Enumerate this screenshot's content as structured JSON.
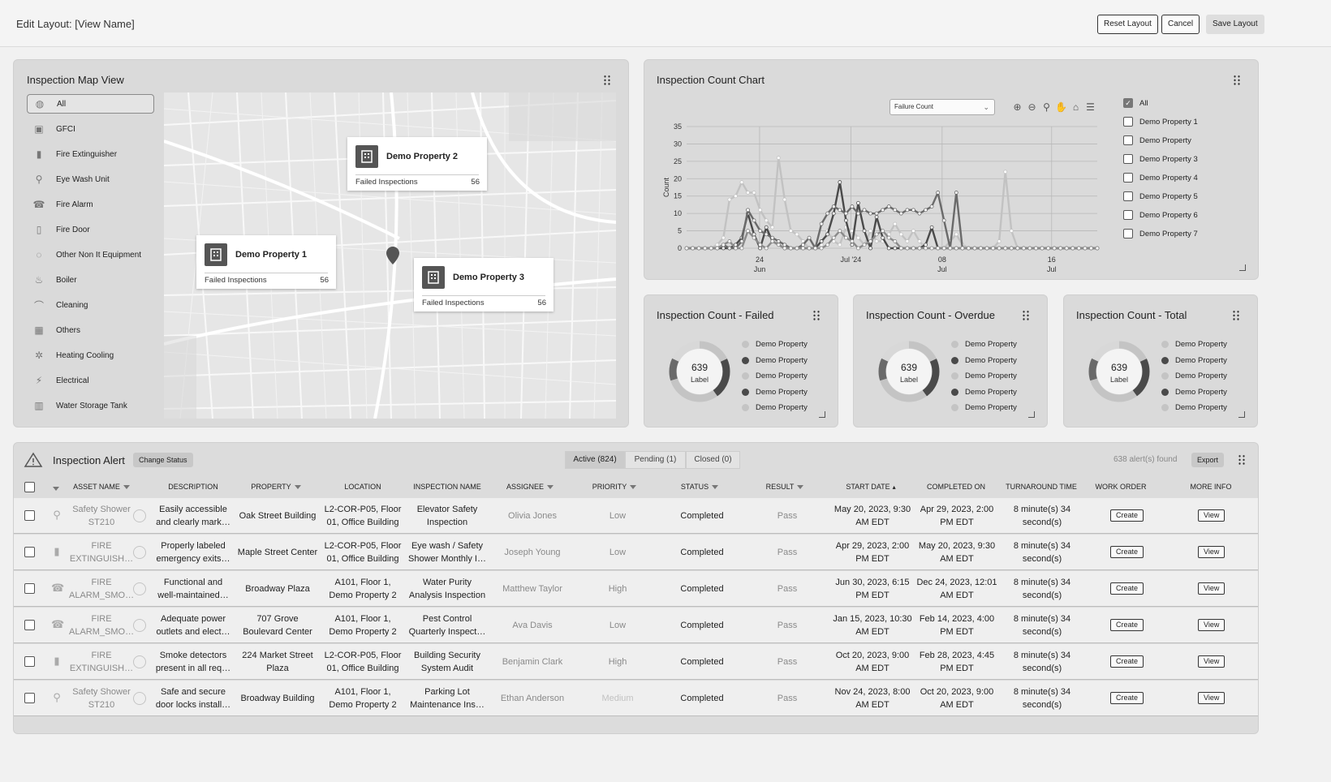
{
  "header": {
    "title": "Edit Layout: [View Name]",
    "reset_label": "Reset Layout",
    "cancel_label": "Cancel",
    "save_label": "Save Layout"
  },
  "map_card": {
    "title": "Inspection Map View",
    "filters": [
      {
        "label": "All",
        "icon": "globe-icon"
      },
      {
        "label": "GFCI",
        "icon": "outlet-icon"
      },
      {
        "label": "Fire Extinguisher",
        "icon": "fire-extinguisher-icon"
      },
      {
        "label": "Eye Wash Unit",
        "icon": "eye-wash-icon"
      },
      {
        "label": "Fire Alarm",
        "icon": "fire-alarm-icon"
      },
      {
        "label": "Fire Door",
        "icon": "door-icon"
      },
      {
        "label": "Other Non It Equipment",
        "icon": "equipment-icon"
      },
      {
        "label": "Boiler",
        "icon": "boiler-icon"
      },
      {
        "label": "Cleaning",
        "icon": "cleaning-icon"
      },
      {
        "label": "Others",
        "icon": "grid-icon"
      },
      {
        "label": "Heating Cooling",
        "icon": "hvac-icon"
      },
      {
        "label": "Electrical",
        "icon": "plug-icon"
      },
      {
        "label": "Water Storage Tank",
        "icon": "tank-icon"
      }
    ],
    "popups": [
      {
        "name": "Demo Property 2",
        "label": "Failed Inspections",
        "value": "56"
      },
      {
        "name": "Demo Property 1",
        "label": "Failed Inspections",
        "value": "56"
      },
      {
        "name": "Demo Property 3",
        "label": "Failed Inspections",
        "value": "56"
      }
    ]
  },
  "count_chart": {
    "title": "Inspection Count Chart",
    "select_value": "Failure Count",
    "legend": [
      {
        "label": "All",
        "checked": true
      },
      {
        "label": "Demo Property 1",
        "checked": false
      },
      {
        "label": "Demo Property",
        "checked": false
      },
      {
        "label": "Demo Property 3",
        "checked": false
      },
      {
        "label": "Demo Property 4",
        "checked": false
      },
      {
        "label": "Demo Property 5",
        "checked": false
      },
      {
        "label": "Demo Property 6",
        "checked": false
      },
      {
        "label": "Demo Property 7",
        "checked": false
      }
    ]
  },
  "chart_data": {
    "type": "line",
    "ylabel": "Count",
    "ylim": [
      0,
      35
    ],
    "yticks": [
      0,
      5,
      10,
      15,
      20,
      25,
      30,
      35
    ],
    "xticks": [
      {
        "label": "24",
        "sub": "Jun",
        "x": 4
      },
      {
        "label": "Jul '24",
        "sub": "",
        "x": 9
      },
      {
        "label": "08",
        "sub": "Jul",
        "x": 14
      },
      {
        "label": "16",
        "sub": "Jul",
        "x": 20
      }
    ],
    "xlim": [
      0,
      22.5
    ],
    "series": [
      {
        "color": "#c2c2c2",
        "values": [
          0,
          0,
          0,
          0,
          0,
          1,
          3,
          14,
          15,
          19,
          16,
          16,
          11,
          8,
          6,
          26,
          14,
          5,
          4,
          2,
          0,
          0,
          1,
          5,
          2,
          1,
          6,
          5,
          3,
          1,
          5,
          2,
          2,
          4,
          7,
          4,
          2,
          5,
          2,
          0,
          0,
          0,
          0,
          2,
          4,
          1,
          0,
          0,
          0,
          0,
          0,
          2,
          22,
          5,
          0,
          0,
          0,
          0,
          0,
          0,
          0,
          0,
          0,
          0,
          0,
          0,
          0,
          0
        ]
      },
      {
        "color": "#4a4a4a",
        "values": [
          0,
          0,
          0,
          0,
          0,
          0,
          0,
          0,
          1,
          3,
          10,
          4,
          0,
          6,
          2,
          1,
          0,
          0,
          0,
          0,
          0,
          0,
          2,
          4,
          10,
          19,
          8,
          1,
          13,
          5,
          0,
          9,
          3,
          0,
          0,
          0,
          0,
          0,
          0,
          1,
          6,
          0,
          0,
          0,
          0,
          0,
          0,
          0,
          0,
          0,
          0,
          0,
          0,
          0,
          0,
          0,
          0,
          0,
          0,
          0,
          0,
          0,
          0,
          0,
          0,
          0,
          0,
          0
        ]
      },
      {
        "color": "#6a6a6a",
        "values": [
          0,
          0,
          0,
          0,
          0,
          0,
          1,
          0,
          0,
          2,
          11,
          8,
          5,
          4,
          3,
          2,
          1,
          0,
          0,
          1,
          3,
          0,
          7,
          10,
          12,
          11,
          10,
          12,
          10,
          11,
          10,
          10,
          11,
          12,
          11,
          10,
          11,
          11,
          10,
          11,
          12,
          16,
          8,
          0,
          16,
          0,
          0,
          0,
          0,
          0,
          0,
          0,
          0,
          0,
          0,
          0,
          0,
          0,
          0,
          0,
          0,
          0,
          0,
          0,
          0,
          0,
          0,
          0
        ]
      },
      {
        "color": "#8a8a8a",
        "values": [
          0,
          0,
          0,
          0,
          0,
          0,
          1,
          2,
          0,
          0,
          5,
          3,
          1,
          0,
          2,
          1,
          0,
          0,
          0,
          0,
          0,
          0,
          0,
          1,
          3,
          5,
          3,
          2,
          0,
          1,
          2,
          4,
          5,
          3,
          2,
          0,
          0,
          0,
          0,
          0,
          0,
          0,
          0,
          0,
          0,
          0,
          0,
          0,
          0,
          0,
          0,
          0,
          0,
          0,
          0,
          0,
          0,
          0,
          0,
          0,
          0,
          0,
          0,
          0,
          0,
          0,
          0,
          0
        ]
      }
    ]
  },
  "donuts": [
    {
      "title": "Inspection Count - Failed",
      "value": "639",
      "label": "Label",
      "legend": [
        {
          "label": "Demo Property",
          "color": "#c4c4c4"
        },
        {
          "label": "Demo Property",
          "color": "#4a4a4a"
        },
        {
          "label": "Demo Property",
          "color": "#c4c4c4"
        },
        {
          "label": "Demo Property",
          "color": "#4a4a4a"
        },
        {
          "label": "Demo Property",
          "color": "#c4c4c4"
        }
      ]
    },
    {
      "title": "Inspection Count - Overdue",
      "value": "639",
      "label": "Label",
      "legend": [
        {
          "label": "Demo Property",
          "color": "#c4c4c4"
        },
        {
          "label": "Demo Property",
          "color": "#4a4a4a"
        },
        {
          "label": "Demo Property",
          "color": "#c4c4c4"
        },
        {
          "label": "Demo Property",
          "color": "#4a4a4a"
        },
        {
          "label": "Demo Property",
          "color": "#c4c4c4"
        }
      ]
    },
    {
      "title": "Inspection Count - Total",
      "value": "639",
      "label": "Label",
      "legend": [
        {
          "label": "Demo Property",
          "color": "#c4c4c4"
        },
        {
          "label": "Demo Property",
          "color": "#4a4a4a"
        },
        {
          "label": "Demo Property",
          "color": "#c4c4c4"
        },
        {
          "label": "Demo Property",
          "color": "#4a4a4a"
        },
        {
          "label": "Demo Property",
          "color": "#c4c4c4"
        }
      ]
    }
  ],
  "alerts": {
    "title": "Inspection Alert",
    "change_status_label": "Change Status",
    "tabs": [
      "Active (824)",
      "Pending (1)",
      "Closed (0)"
    ],
    "found": "638 alert(s) found",
    "export_label": "Export",
    "columns": [
      "ASSET NAME",
      "DESCRIPTION",
      "PROPERTY",
      "LOCATION",
      "INSPECTION NAME",
      "ASSIGNEE",
      "PRIORITY",
      "STATUS",
      "RESULT",
      "START DATE",
      "COMPLETED ON",
      "TURNAROUND TIME",
      "WORK ORDER",
      "MORE INFO"
    ],
    "create_label": "Create",
    "view_label": "View",
    "rows": [
      {
        "asset": [
          "Safety Shower",
          "ST210"
        ],
        "icon": "shower-icon",
        "desc": [
          "Easily accessible",
          "and clearly mark…"
        ],
        "property": [
          "Oak Street Building"
        ],
        "location": [
          "L2-COR-P05, Floor",
          "01, Office Building"
        ],
        "insp": [
          "Elevator Safety",
          "Inspection"
        ],
        "assignee": "Olivia Jones",
        "priority": "Low",
        "status": "Completed",
        "result": "Pass",
        "start": [
          "May 20, 2023, 9:30",
          "AM EDT"
        ],
        "completed": [
          "Apr 29, 2023, 2:00",
          "PM EDT"
        ],
        "tat": [
          "8 minute(s) 34",
          "second(s)"
        ]
      },
      {
        "asset": [
          "FIRE",
          "EXTINGUISH…"
        ],
        "icon": "fire-extinguisher-icon",
        "desc": [
          "Properly labeled",
          "emergency exits…"
        ],
        "property": [
          "Maple Street Center"
        ],
        "location": [
          "L2-COR-P05, Floor",
          "01, Office Building"
        ],
        "insp": [
          "Eye wash / Safety",
          "Shower Monthly I…"
        ],
        "assignee": "Joseph Young",
        "priority": "Low",
        "status": "Completed",
        "result": "Pass",
        "start": [
          "Apr 29, 2023, 2:00",
          "PM EDT"
        ],
        "completed": [
          "May 20, 2023, 9:30",
          "AM EDT"
        ],
        "tat": [
          "8 minute(s) 34",
          "second(s)"
        ]
      },
      {
        "asset": [
          "FIRE",
          "ALARM_SMO…"
        ],
        "icon": "fire-alarm-icon",
        "desc": [
          "Functional and",
          "well-maintained…"
        ],
        "property": [
          "Broadway Plaza"
        ],
        "location": [
          "A101, Floor 1,",
          "Demo Property 2"
        ],
        "insp": [
          "Water Purity",
          "Analysis Inspection"
        ],
        "assignee": "Matthew Taylor",
        "priority": "High",
        "status": "Completed",
        "result": "Pass",
        "start": [
          "Jun 30, 2023, 6:15",
          "PM EDT"
        ],
        "completed": [
          "Dec 24, 2023, 12:01",
          "AM EDT"
        ],
        "tat": [
          "8 minute(s) 34",
          "second(s)"
        ]
      },
      {
        "asset": [
          "FIRE",
          "ALARM_SMO…"
        ],
        "icon": "fire-alarm-icon",
        "desc": [
          "Adequate power",
          "outlets and elect…"
        ],
        "property": [
          "707 Grove",
          "Boulevard Center"
        ],
        "location": [
          "A101, Floor 1,",
          "Demo Property 2"
        ],
        "insp": [
          "Pest Control",
          "Quarterly Inspect…"
        ],
        "assignee": "Ava Davis",
        "priority": "Low",
        "status": "Completed",
        "result": "Pass",
        "start": [
          "Jan 15, 2023, 10:30",
          "AM EDT"
        ],
        "completed": [
          "Feb 14, 2023, 4:00",
          "PM EDT"
        ],
        "tat": [
          "8 minute(s) 34",
          "second(s)"
        ]
      },
      {
        "asset": [
          "FIRE",
          "EXTINGUISH…"
        ],
        "icon": "fire-extinguisher-icon",
        "desc": [
          "Smoke detectors",
          "present in all req…"
        ],
        "property": [
          "224 Market Street",
          "Plaza"
        ],
        "location": [
          "L2-COR-P05, Floor",
          "01, Office Building"
        ],
        "insp": [
          "Building Security",
          "System Audit"
        ],
        "assignee": "Benjamin Clark",
        "priority": "High",
        "status": "Completed",
        "result": "Pass",
        "start": [
          "Oct 20, 2023, 9:00",
          "AM EDT"
        ],
        "completed": [
          "Feb 28, 2023, 4:45",
          "PM EDT"
        ],
        "tat": [
          "8 minute(s) 34",
          "second(s)"
        ]
      },
      {
        "asset": [
          "Safety Shower",
          "ST210"
        ],
        "icon": "shower-icon",
        "desc": [
          "Safe and secure",
          "door locks install…"
        ],
        "property": [
          "Broadway Building"
        ],
        "location": [
          "A101, Floor 1,",
          "Demo Property 2"
        ],
        "insp": [
          "Parking Lot",
          "Maintenance Ins…"
        ],
        "assignee": "Ethan Anderson",
        "priority": "Medium",
        "status": "Completed",
        "result": "Pass",
        "start": [
          "Nov 24, 2023, 8:00",
          "AM EDT"
        ],
        "completed": [
          "Oct 20, 2023, 9:00",
          "AM EDT"
        ],
        "tat": [
          "8 minute(s) 34",
          "second(s)"
        ]
      }
    ]
  }
}
